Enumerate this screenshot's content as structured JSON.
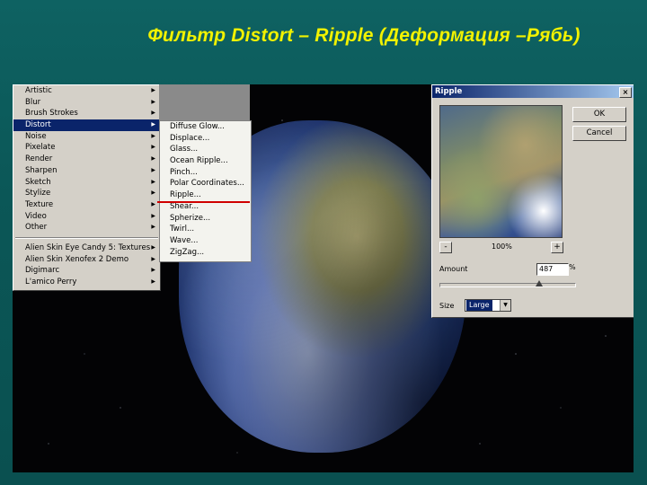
{
  "slide": {
    "title": "Фильтр Distort – Ripple (Деформация –Рябь)"
  },
  "filter_menu": {
    "items": [
      {
        "label": "Artistic",
        "submenu": true
      },
      {
        "label": "Blur",
        "submenu": true
      },
      {
        "label": "Brush Strokes",
        "submenu": true
      },
      {
        "label": "Distort",
        "submenu": true,
        "selected": true
      },
      {
        "label": "Noise",
        "submenu": true
      },
      {
        "label": "Pixelate",
        "submenu": true
      },
      {
        "label": "Render",
        "submenu": true
      },
      {
        "label": "Sharpen",
        "submenu": true
      },
      {
        "label": "Sketch",
        "submenu": true
      },
      {
        "label": "Stylize",
        "submenu": true
      },
      {
        "label": "Texture",
        "submenu": true
      },
      {
        "label": "Video",
        "submenu": true
      },
      {
        "label": "Other",
        "submenu": true
      }
    ],
    "plugin_items": [
      {
        "label": "Alien Skin Eye Candy 5: Textures",
        "submenu": true
      },
      {
        "label": "Alien Skin Xenofex 2 Demo",
        "submenu": true
      },
      {
        "label": "Digimarc",
        "submenu": true
      },
      {
        "label": "L'amico Perry",
        "submenu": true
      }
    ]
  },
  "distort_submenu": {
    "items": [
      "Diffuse Glow...",
      "Displace...",
      "Glass...",
      "Ocean Ripple...",
      "Pinch...",
      "Polar Coordinates...",
      "Ripple...",
      "Shear...",
      "Spherize...",
      "Twirl...",
      "Wave...",
      "ZigZag..."
    ],
    "highlighted": "Ripple..."
  },
  "ripple_dialog": {
    "title": "Ripple",
    "close_glyph": "×",
    "ok_label": "OK",
    "cancel_label": "Cancel",
    "zoom_out_label": "-",
    "zoom_in_label": "+",
    "zoom_value": "100%",
    "amount_label": "Amount",
    "amount_value": "487",
    "amount_unit": "%",
    "amount_slider_fraction": 0.74,
    "size_label": "Size",
    "size_value": "Large",
    "dropdown_glyph": "▼"
  },
  "colors": {
    "title_color": "#f2f200",
    "menu_highlight": "#0a246a",
    "red_underline": "#d00000"
  }
}
